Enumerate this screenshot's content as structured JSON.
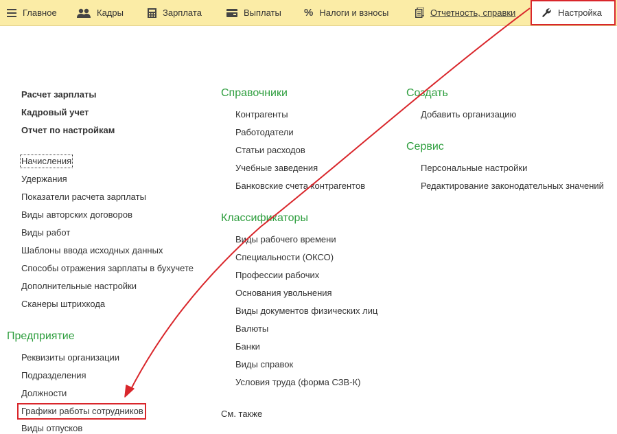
{
  "top_nav": {
    "tabs": [
      {
        "label": "Главное",
        "icon": "menu-lines-icon"
      },
      {
        "label": "Кадры",
        "icon": "people-icon"
      },
      {
        "label": "Зарплата",
        "icon": "calculator-icon"
      },
      {
        "label": "Выплаты",
        "icon": "wallet-icon"
      },
      {
        "label": "Налоги и взносы",
        "icon": "percent-icon"
      },
      {
        "label": "Отчетность, справки",
        "icon": "documents-icon"
      },
      {
        "label": "Настройка",
        "icon": "wrench-icon",
        "active": true
      }
    ]
  },
  "left_column": {
    "bold_links": [
      "Расчет зарплаты",
      "Кадровый учет",
      "Отчет по настройкам"
    ],
    "links": [
      "Начисления",
      "Удержания",
      "Показатели расчета зарплаты",
      "Виды авторских договоров",
      "Виды работ",
      "Шаблоны ввода исходных данных",
      "Способы отражения зарплаты в бухучете",
      "Дополнительные настройки",
      "Сканеры штрихкода"
    ],
    "enterprise": {
      "title": "Предприятие",
      "links": [
        "Реквизиты организации",
        "Подразделения",
        "Должности",
        "Графики работы сотрудников",
        "Виды отпусков"
      ]
    }
  },
  "middle_column": {
    "directories": {
      "title": "Справочники",
      "links": [
        "Контрагенты",
        "Работодатели",
        "Статьи расходов",
        "Учебные заведения",
        "Банковские счета контрагентов"
      ]
    },
    "classifiers": {
      "title": "Классификаторы",
      "links": [
        "Виды рабочего времени",
        "Специальности (ОКСО)",
        "Профессии рабочих",
        "Основания увольнения",
        "Виды документов физических лиц",
        "Валюты",
        "Банки",
        "Виды справок",
        "Условия труда (форма СЗВ-К)"
      ]
    },
    "see_also": "См. также"
  },
  "right_column": {
    "create": {
      "title": "Создать",
      "links": [
        "Добавить организацию"
      ]
    },
    "service": {
      "title": "Сервис",
      "links": [
        "Персональные настройки",
        "Редактирование законодательных значений"
      ]
    }
  },
  "colors": {
    "topbar_bg": "#fbeca6",
    "group_title": "#2e9e3e",
    "annotation_red": "#d9262b"
  }
}
